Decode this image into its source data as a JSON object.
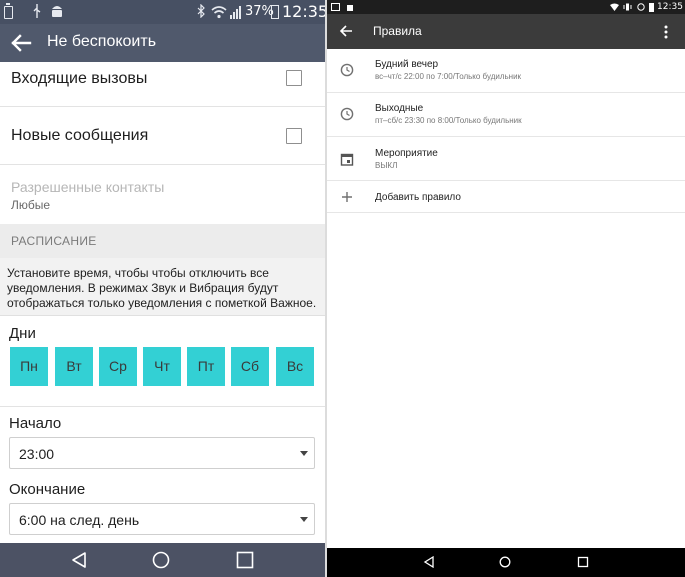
{
  "left": {
    "status": {
      "battery_percent": "37%",
      "time": "12:35"
    },
    "appbar": {
      "title": "Не беспокоить"
    },
    "rows": {
      "incoming_calls": "Входящие вызовы",
      "new_messages": "Новые сообщения",
      "allowed_contacts": "Разрешенные контакты",
      "allowed_contacts_value": "Любые"
    },
    "schedule": {
      "header": "РАСПИСАНИЕ",
      "description": "Установите время, чтобы чтобы отключить все уведомления. В режимах Звук и Вибрация будут отображаться только уведомления с пометкой Важное.",
      "days_label": "Дни",
      "days": [
        "Пн",
        "Вт",
        "Ср",
        "Чт",
        "Пт",
        "Сб",
        "Вс"
      ],
      "start_label": "Начало",
      "start_value": "23:00",
      "end_label": "Окончание",
      "end_value": "6:00 на след. день"
    }
  },
  "right": {
    "status": {
      "time": "12:35"
    },
    "appbar": {
      "title": "Правила"
    },
    "rules": [
      {
        "title": "Будний вечер",
        "subtitle": "вс–чт/с 22:00 по 7:00/Только будильник"
      },
      {
        "title": "Выходные",
        "subtitle": "пт–сб/с 23:30 по 8:00/Только будильник"
      },
      {
        "title": "Мероприятие",
        "subtitle": "ВЫКЛ"
      }
    ],
    "add_rule": "Добавить правило"
  },
  "colors": {
    "left_appbar": "#50596c",
    "day_chip": "#33d0d4",
    "right_appbar": "#3b3b3b"
  },
  "icons": [
    "back-arrow-icon",
    "checkbox-icon",
    "dropdown-caret-icon",
    "clock-icon",
    "calendar-icon",
    "plus-icon",
    "more-vert-icon",
    "nav-back-icon",
    "nav-home-icon",
    "nav-recents-icon",
    "wifi-icon",
    "signal-icon",
    "battery-icon",
    "bluetooth-icon",
    "usb-icon",
    "android-icon",
    "alarm-icon",
    "vibrate-icon",
    "image-icon"
  ]
}
